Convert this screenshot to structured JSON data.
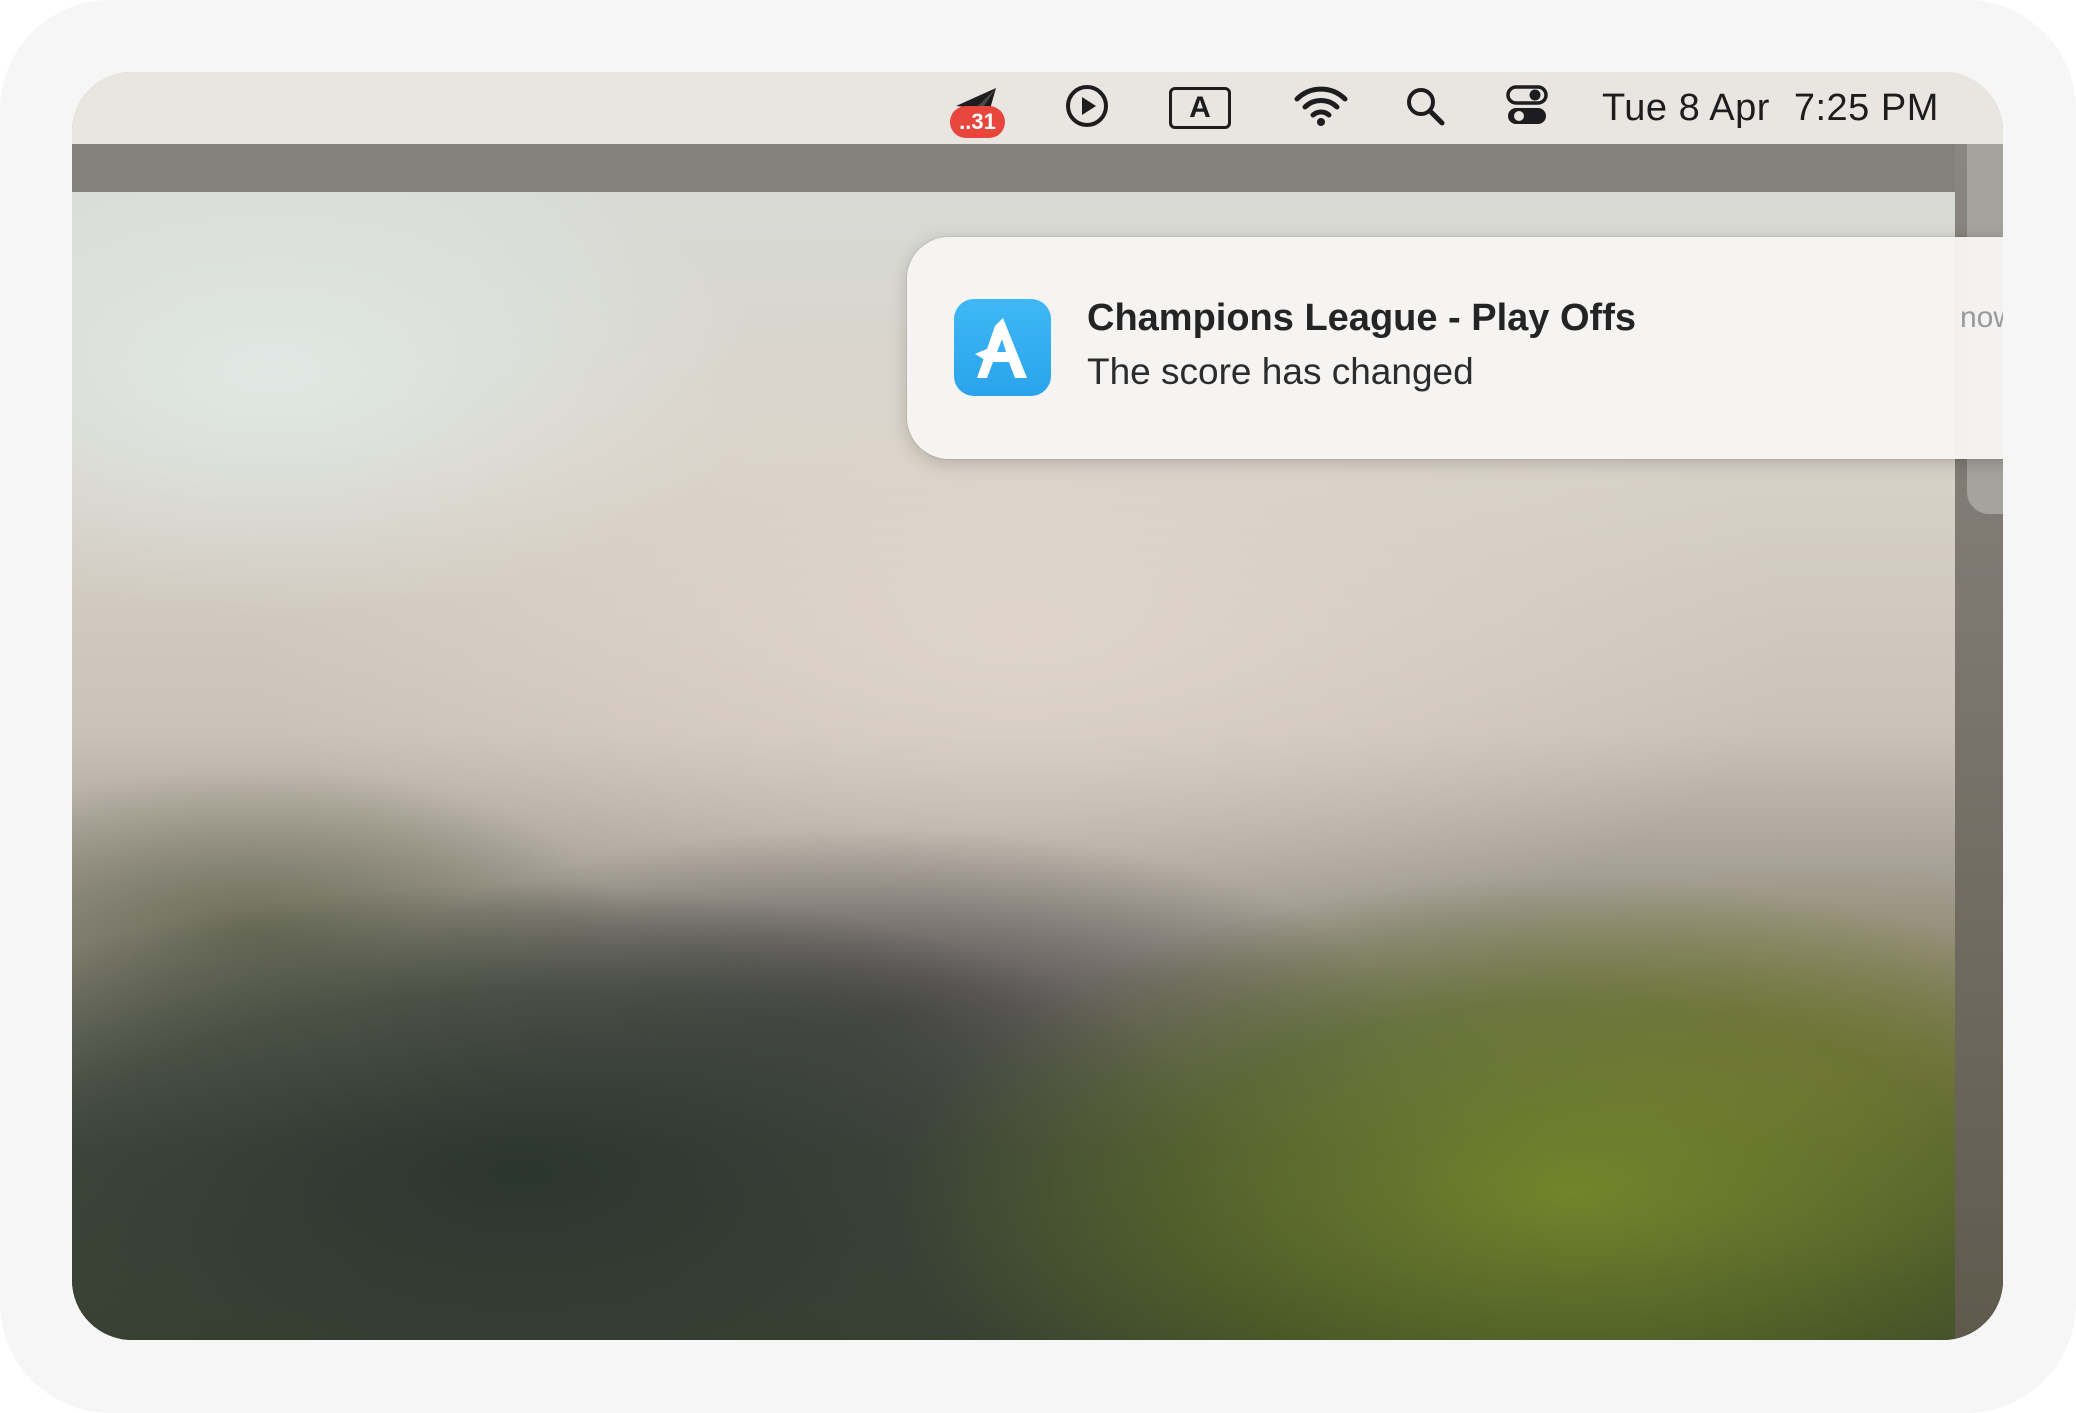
{
  "menubar": {
    "badge_count": "..31",
    "input_source_letter": "A",
    "clock_date": "Tue 8 Apr",
    "clock_time": "7:25 PM",
    "icons": [
      "send-status-icon",
      "play-circle-icon",
      "input-source-icon",
      "wifi-icon",
      "spotlight-search-icon",
      "control-center-icon"
    ]
  },
  "notification": {
    "app_icon": "app-a-icon",
    "app_icon_letter": "A",
    "title": "Champions League - Play Offs",
    "body": "The score has changed",
    "time": "now"
  },
  "colors": {
    "badge": "#e8453c",
    "app_icon": "#2aa3ec",
    "menubar": "#e9e6e2",
    "notification_bg": "#f6f5f3"
  }
}
